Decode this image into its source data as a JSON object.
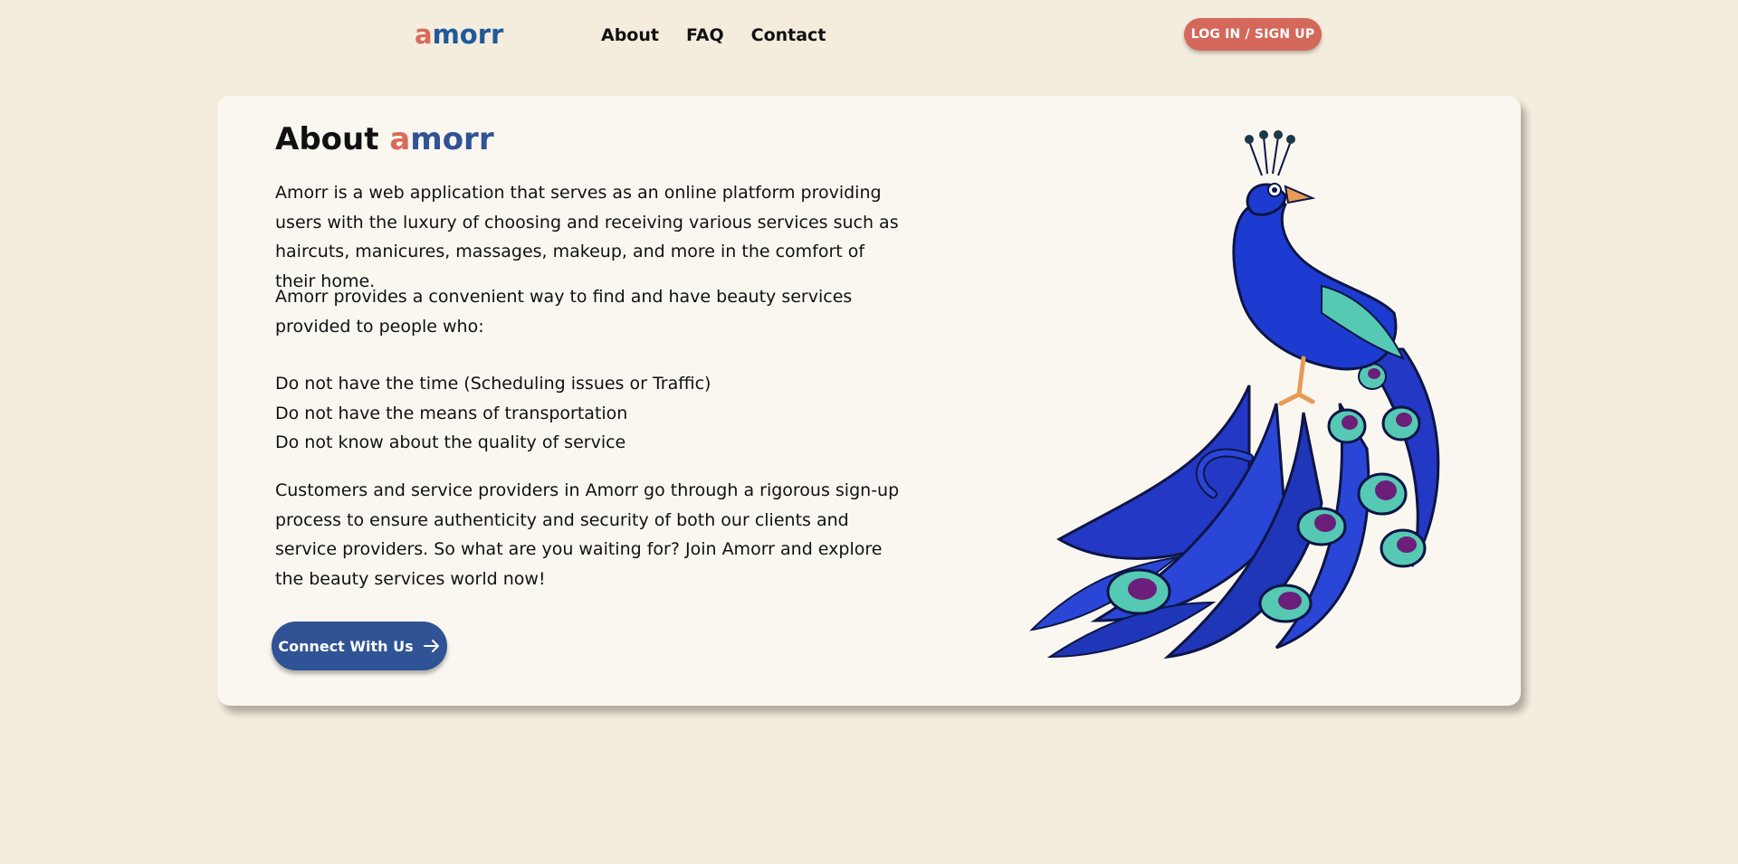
{
  "header": {
    "logo_first": "a",
    "logo_rest": "morr",
    "nav": [
      "About",
      "FAQ",
      "Contact"
    ],
    "login_label": "LOG IN / SIGN UP"
  },
  "about": {
    "title_prefix": "About",
    "title_brand_first": "a",
    "title_brand_rest": "morr",
    "paragraph1": "Amorr is a web application that serves as an online platform providing users with the luxury of choosing and receiving various services such as haircuts, manicures, massages, makeup, and more in the comfort of their home.",
    "paragraph2": "Amorr provides a convenient way to find and have beauty services provided to people who:",
    "list": [
      "Do not have the time (Scheduling issues or Traffic)",
      "Do not have the means of transportation",
      "Do not know about the quality of service"
    ],
    "paragraph3": "Customers and service providers in Amorr go through a rigorous sign-up process to ensure authenticity and security of both our clients and service providers. So what are you waiting for? Join Amorr and explore the beauty services world now!",
    "cta_label": "Connect With Us",
    "cta_icon": "arrow-right-icon",
    "illustration": "peacock-illustration"
  },
  "colors": {
    "background": "#f4ecdd",
    "card": "#faf7f0",
    "brand_coral": "#d96b5a",
    "brand_blue": "#2f5394",
    "logo_blue": "#1f5a99"
  }
}
